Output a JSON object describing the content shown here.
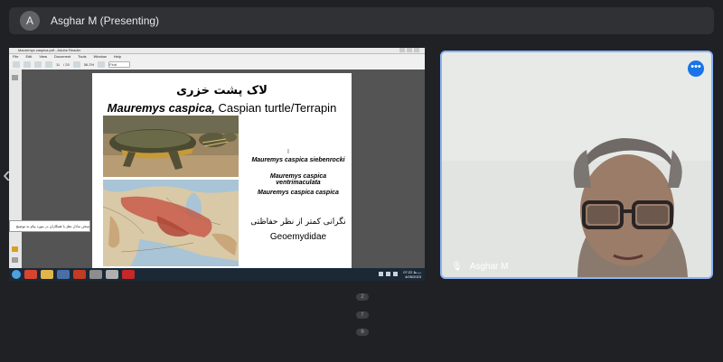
{
  "header": {
    "avatar_letter": "A",
    "presenter": "Asghar M (Presenting)"
  },
  "app": {
    "title": "Mauremys caspica.pdf - Adobe Reader",
    "menu": [
      "File",
      "Edit",
      "View",
      "Document",
      "Tools",
      "Window",
      "Help"
    ],
    "page_number": "11",
    "page_total": "/ 20",
    "zoom": "56.2%",
    "tool_select": "Find"
  },
  "slide": {
    "title_fa": "لاک پشت خزری",
    "title_sci": "Mauremys caspica,",
    "title_common": " Caspian turtle/Terrapin",
    "subspecies": [
      "Mauremys caspica siebenrocki",
      "Mauremys caspica ventrimaculata",
      "Mauremys caspica caspica"
    ],
    "status_fa": "نگرانی کمتر از نظر حفاظتی",
    "family": "Geoemydidae"
  },
  "popup": {
    "text": "سخن تبادل نظر با همکاران در مورد پیام به توضیح"
  },
  "taskbar": {
    "time": "07:22 ب.ظ",
    "date": "4/05/2023"
  },
  "video": {
    "name": "Asghar M",
    "menu_label": "•••"
  },
  "pager": [
    "2",
    "f",
    "6"
  ],
  "colors": {
    "accent": "#8ab4f8",
    "menu_button": "#1a73e8",
    "background": "#202124"
  }
}
